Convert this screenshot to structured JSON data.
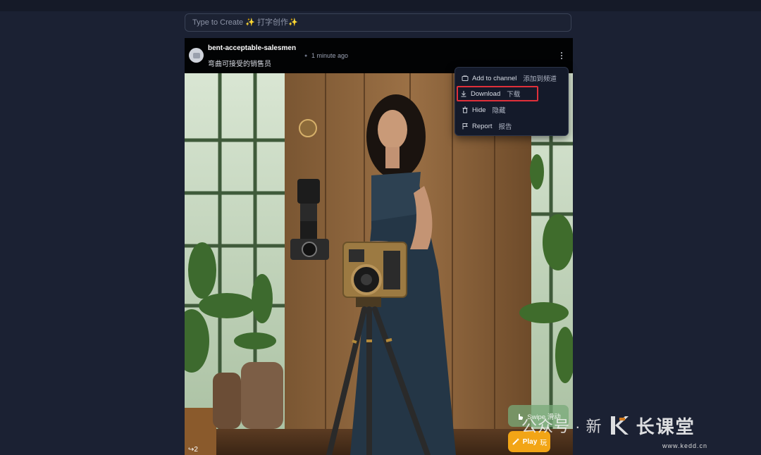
{
  "prompt": {
    "placeholder": "Type to Create ✨ 打字创作✨"
  },
  "post": {
    "username": "bent-acceptable-salesmen",
    "subtitle": "弯曲可接受的销售员",
    "time": "1 minute ago",
    "share_count": "2"
  },
  "menu": {
    "items": [
      {
        "label": "Add to channel",
        "cn": "添加到频道",
        "icon": "channel-icon"
      },
      {
        "label": "Download",
        "cn": "下载",
        "icon": "download-icon"
      },
      {
        "label": "Hide",
        "cn": "隐藏",
        "icon": "trash-icon"
      },
      {
        "label": "Report",
        "cn": "报告",
        "icon": "flag-icon"
      }
    ]
  },
  "actions": {
    "swipe_label": "Swipe 滑动",
    "play_label": "Play",
    "play_cn": "玩"
  },
  "watermark": {
    "text": "公众号 · 新",
    "brand": "长课堂",
    "url": "www.kedd.cn"
  },
  "colors": {
    "background": "#1b2133",
    "highlight": "#e0303a",
    "play": "#f2a516"
  }
}
